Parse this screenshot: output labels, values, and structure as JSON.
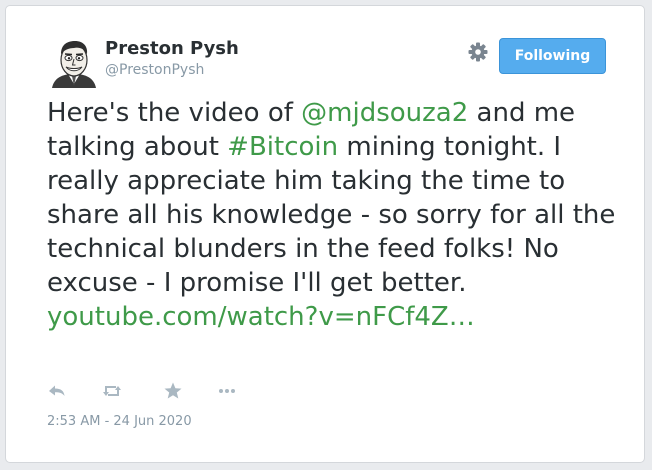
{
  "author": {
    "name": "Preston Pysh",
    "handle": "@PrestonPysh",
    "avatar_icon": "caricature-avatar"
  },
  "header": {
    "settings_icon": "gear-icon",
    "follow_label": "Following"
  },
  "tweet": {
    "text_1": "Here's the video of ",
    "mention": "@mjdsouza2",
    "text_2": " and me talking about ",
    "hashtag": "#Bitcoin",
    "text_3": " mining tonight. I really appreciate him taking the time to share all his knowledge - so sorry for all the technical blunders in the feed folks! No excuse - I promise I'll get better. ",
    "link": "youtube.com/watch?v=nFCf4Z…"
  },
  "actions": {
    "reply_icon": "reply-icon",
    "retweet_icon": "retweet-icon",
    "like_icon": "star-icon",
    "more_icon": "more-icon"
  },
  "timestamp": "2:53 AM - 24 Jun 2020",
  "colors": {
    "accent_link": "#3f9a49",
    "button_bg": "#55acee",
    "text": "#292f33",
    "muted": "#8899a6",
    "icon": "#aab8c2"
  }
}
